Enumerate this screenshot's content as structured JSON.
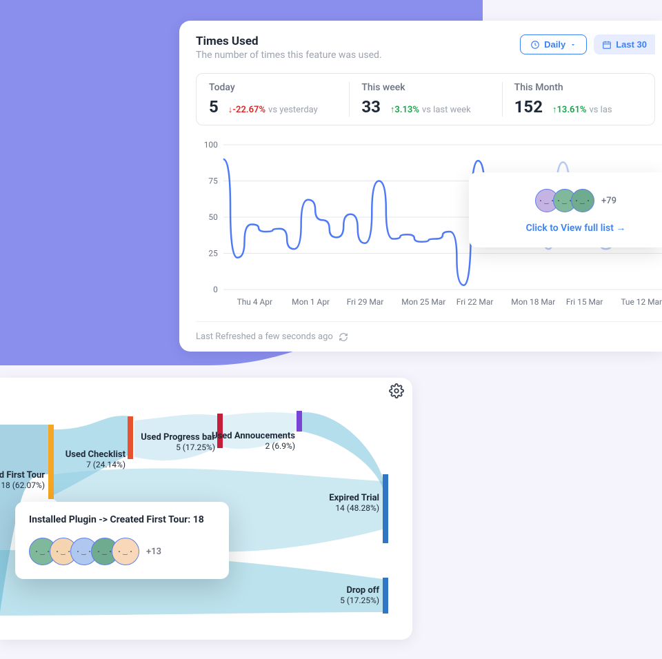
{
  "card1": {
    "title": "Times Used",
    "subtitle": "The number of times this feature was used.",
    "daily_label": "Daily",
    "range_label": "Last 30",
    "stats": [
      {
        "label": "Today",
        "value": "5",
        "delta": "-22.67%",
        "direction": "down",
        "vs": "vs yesterday"
      },
      {
        "label": "This week",
        "value": "33",
        "delta": "3.13%",
        "direction": "up",
        "vs": "vs last week"
      },
      {
        "label": "This Month",
        "value": "152",
        "delta": "13.61%",
        "direction": "up",
        "vs": "vs las"
      }
    ],
    "overlay": {
      "count": "+79",
      "link": "Click to View full list →"
    },
    "footer": "Last Refreshed a few seconds ago"
  },
  "chart_data": {
    "type": "line",
    "ylim": [
      0,
      100
    ],
    "yticks": [
      0,
      25,
      50,
      75,
      100
    ],
    "xticks": [
      "Thu 4 Apr",
      "Mon 1 Apr",
      "Fri 29 Mar",
      "Mon 25 Mar",
      "Fri 22 Mar",
      "Mon 18 Mar",
      "Fri 15 Mar",
      "Tue 12 Mar"
    ],
    "values": [
      90,
      22,
      45,
      40,
      42,
      28,
      62,
      48,
      36,
      52,
      32,
      75,
      35,
      38,
      33,
      35,
      40,
      3,
      89,
      30,
      36,
      32,
      60,
      28,
      88,
      32,
      48,
      28,
      38,
      35,
      44,
      36
    ],
    "title": "",
    "xlabel": "",
    "ylabel": ""
  },
  "card2": {
    "nodes": {
      "first_tour": {
        "label": "d First Tour",
        "sub": "18 (62.07%)"
      },
      "checklist": {
        "label": "Used Checklist",
        "sub": "7 (24.14%)"
      },
      "progress": {
        "label": "Used Progress bar",
        "sub": "5 (17.25%)"
      },
      "announce": {
        "label": "Used Annoucements",
        "sub": "2 (6.9%)"
      },
      "expired": {
        "label": "Expired Trial",
        "sub": "14 (48.28%)"
      },
      "dropoff": {
        "label": "Drop off",
        "sub": "5 (17.25%)"
      }
    },
    "tooltip": {
      "title": "Installed Plugin -> Created First Tour: 18",
      "count": "+13"
    }
  }
}
